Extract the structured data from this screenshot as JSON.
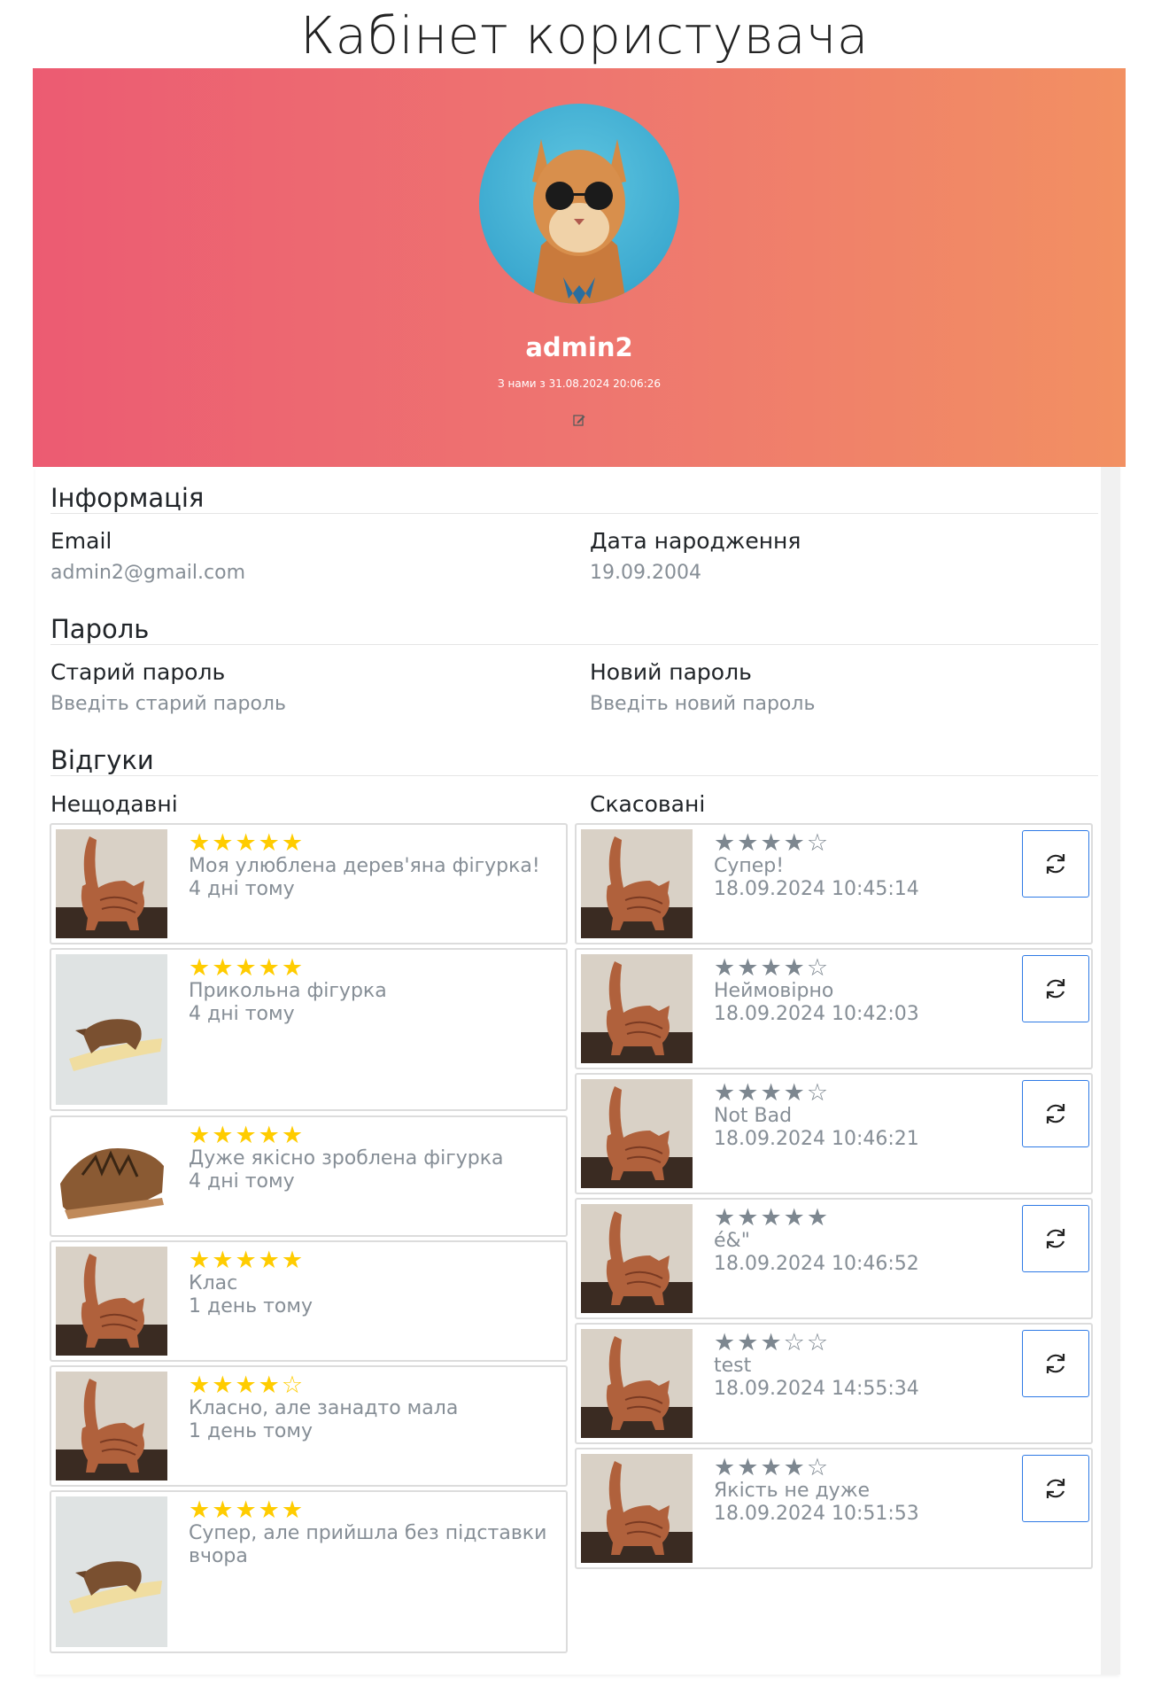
{
  "page_title": "Кабінет користувача",
  "profile": {
    "username": "admin2",
    "member_since": "З нами з 31.08.2024 20:06:26",
    "edit_icon": "edit-icon"
  },
  "info": {
    "title": "Інформація",
    "email_label": "Email",
    "email_value": "admin2@gmail.com",
    "birth_label": "Дата народження",
    "birth_value": "19.09.2004"
  },
  "password": {
    "title": "Пароль",
    "old_label": "Старий пароль",
    "old_placeholder": "Введіть старий пароль",
    "new_label": "Новий пароль",
    "new_placeholder": "Введіть новий пароль"
  },
  "reviews": {
    "title": "Відгуки",
    "recent_title": "Нещодавні",
    "cancelled_title": "Скасовані",
    "recent": [
      {
        "rating": 5,
        "text": "Моя улюблена дерев'яна фігурка!",
        "time": "4 дні тому",
        "image": "cat"
      },
      {
        "rating": 5,
        "text": "Прикольна фігурка",
        "time": "4 дні тому",
        "image": "rhino"
      },
      {
        "rating": 5,
        "text": "Дуже якісно зроблена фігурка",
        "time": "4 дні тому",
        "image": "bear"
      },
      {
        "rating": 5,
        "text": "Клас",
        "time": "1 день тому",
        "image": "cat"
      },
      {
        "rating": 4,
        "text": "Класно, але занадто мала",
        "time": "1 день тому",
        "image": "cat"
      },
      {
        "rating": 5,
        "text": "Супер, але прийшла без підставки",
        "time": "вчора",
        "image": "rhino"
      }
    ],
    "cancelled": [
      {
        "rating": 4,
        "text": "Супер!",
        "time": "18.09.2024 10:45:14",
        "image": "cat"
      },
      {
        "rating": 4,
        "text": "Неймовірно",
        "time": "18.09.2024 10:42:03",
        "image": "cat"
      },
      {
        "rating": 4,
        "text": "Not Bad",
        "time": "18.09.2024 10:46:21",
        "image": "cat"
      },
      {
        "rating": 5,
        "text": "é&\"",
        "time": "18.09.2024 10:46:52",
        "image": "cat"
      },
      {
        "rating": 3,
        "text": "test",
        "time": "18.09.2024 14:55:34",
        "image": "cat"
      },
      {
        "rating": 4,
        "text": "Якість не дуже",
        "time": "18.09.2024 10:51:53",
        "image": "cat"
      }
    ]
  },
  "colors": {
    "star_gold": "#ffcc00",
    "star_grey": "#7d8790",
    "accent": "#2f7ae5"
  }
}
